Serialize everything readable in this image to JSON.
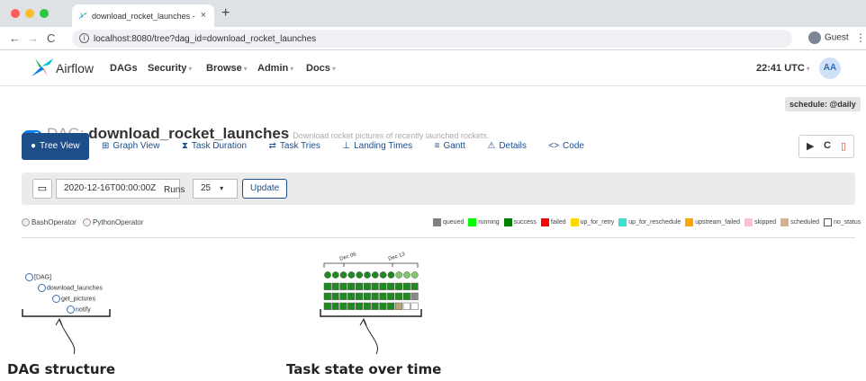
{
  "browser": {
    "tab_title": "download_rocket_launches - ",
    "url": "localhost:8080/tree?dag_id=download_rocket_launches",
    "profile": "Guest"
  },
  "nav": {
    "brand": "Airflow",
    "items": [
      "DAGs",
      "Security",
      "Browse",
      "Admin",
      "Docs"
    ],
    "time": "22:41 UTC",
    "user_initials": "AA"
  },
  "dag": {
    "prefix": "DAG:",
    "id": "download_rocket_launches",
    "description": "Download rocket pictures of recently launched rockets.",
    "schedule": "schedule: @daily"
  },
  "views": [
    {
      "label": "Tree View",
      "icon": "tree-icon",
      "active": true
    },
    {
      "label": "Graph View",
      "icon": "graph-icon"
    },
    {
      "label": "Task Duration",
      "icon": "hourglass-icon"
    },
    {
      "label": "Task Tries",
      "icon": "retry-icon"
    },
    {
      "label": "Landing Times",
      "icon": "landing-icon"
    },
    {
      "label": "Gantt",
      "icon": "gantt-icon"
    },
    {
      "label": "Details",
      "icon": "warning-icon"
    },
    {
      "label": "Code",
      "icon": "code-icon"
    }
  ],
  "filters": {
    "date": "2020-12-16T00:00:00Z",
    "runs_label": "Runs",
    "runs_value": "25",
    "update_label": "Update"
  },
  "operators": [
    {
      "label": "BashOperator",
      "color": "#f0ede4"
    },
    {
      "label": "PythonOperator",
      "color": "#ffefeb"
    }
  ],
  "states": [
    {
      "label": "queued",
      "color": "#808080"
    },
    {
      "label": "running",
      "color": "#00ff00"
    },
    {
      "label": "success",
      "color": "#008000"
    },
    {
      "label": "failed",
      "color": "#ff0000"
    },
    {
      "label": "up_for_retry",
      "color": "#ffd700"
    },
    {
      "label": "up_for_reschedule",
      "color": "#40e0d0"
    },
    {
      "label": "upstream_failed",
      "color": "#ffa500"
    },
    {
      "label": "skipped",
      "color": "#ffc0cb"
    },
    {
      "label": "scheduled",
      "color": "#d2b48c"
    },
    {
      "label": "no_status",
      "color": "#ffffff"
    }
  ],
  "tree": {
    "nodes": [
      "[DAG]",
      "download_launches",
      "get_pictures",
      "notify"
    ]
  },
  "grid": {
    "date_labels": [
      "Dec 06",
      "Dec 13"
    ]
  },
  "annotations": {
    "left": "DAG structure",
    "right": "Task state over time"
  }
}
